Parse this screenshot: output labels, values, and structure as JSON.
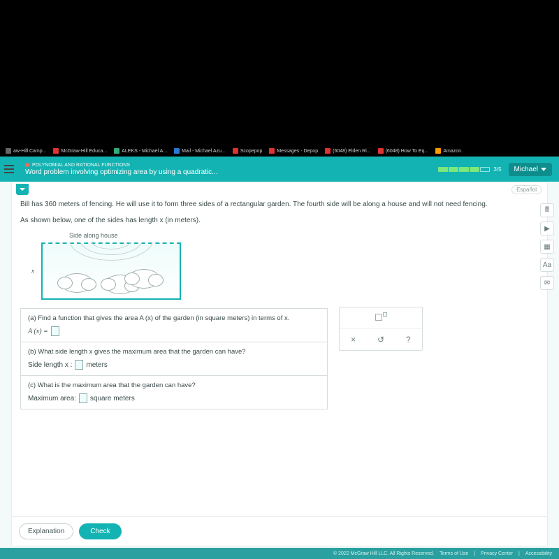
{
  "tabs": [
    {
      "label": "aw-Hill Camp...",
      "icon": "#666"
    },
    {
      "label": "McGraw-Hill Educa...",
      "icon": "#d33"
    },
    {
      "label": "ALEKS - Michael A...",
      "icon": "#3a7",
      "active": true
    },
    {
      "label": "Mail - Michael Azu...",
      "icon": "#2a7ad4"
    },
    {
      "label": "Scopepop",
      "icon": "#d33"
    },
    {
      "label": "Messages - Depop",
      "icon": "#d33"
    },
    {
      "label": "(6048) Elden Ri...",
      "icon": "#d33"
    },
    {
      "label": "(6048) How To Eq...",
      "icon": "#d33"
    },
    {
      "label": "Amazon.",
      "icon": "#f90"
    }
  ],
  "header": {
    "overline": "POLYNOMIAL AND RATIONAL FUNCTIONS",
    "title": "Word problem involving optimizing area by using a quadratic...",
    "progress": {
      "completed": 4,
      "total": 5,
      "label": "3/5"
    },
    "user": "Michael"
  },
  "toolbar": {
    "espanol": "Español"
  },
  "problem": {
    "p1": "Bill has 360 meters of fencing. He will use it to form three sides of a rectangular garden. The fourth side will be along a house and will not need fencing.",
    "p2": "As shown below, one of the sides has length x (in meters).",
    "diagram_caption": "Side along house",
    "x_label": "x"
  },
  "parts": {
    "a": {
      "text": "(a) Find a function that gives the area A (x) of the garden (in square meters) in terms of x.",
      "lhs": "A (x) ="
    },
    "b": {
      "text": "(b) What side length x gives the maximum area that the garden can have?",
      "label_pre": "Side length x :",
      "label_post": "meters"
    },
    "c": {
      "text": "(c) What is the maximum area that the garden can have?",
      "label_pre": "Maximum area:",
      "label_post": "square meters"
    }
  },
  "toolbox": {
    "exponent_tip": "exponent",
    "close": "×",
    "reset": "↺",
    "help": "?"
  },
  "side_tools": [
    "calculator-icon",
    "play-icon",
    "grid-icon",
    "font-icon",
    "mail-icon"
  ],
  "side_glyphs": [
    "🖩",
    "▶",
    "▦",
    "Aa",
    "✉"
  ],
  "buttons": {
    "explanation": "Explanation",
    "check": "Check"
  },
  "footer": {
    "copyright": "© 2022 McGraw Hill LLC. All Rights Reserved.",
    "links": [
      "Terms of Use",
      "Privacy Center",
      "Accessibility"
    ]
  }
}
